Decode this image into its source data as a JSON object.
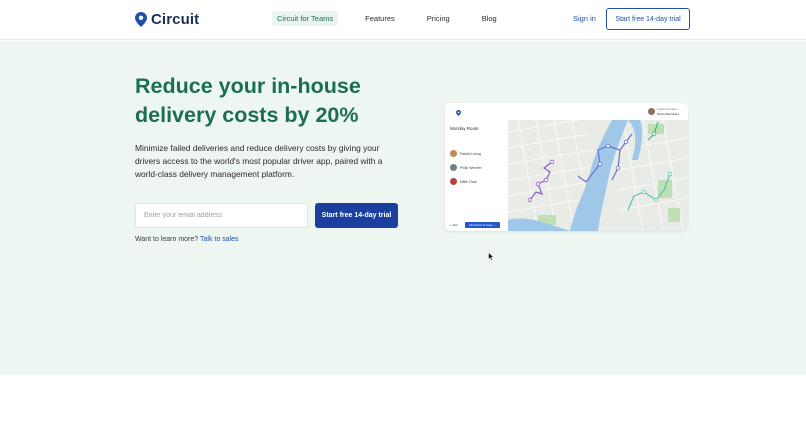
{
  "brand": {
    "name": "Circuit",
    "logo_icon": "map-pin-icon",
    "color": "#2150a6"
  },
  "nav": {
    "items": [
      {
        "label": "Circuit for Teams",
        "active": true
      },
      {
        "label": "Features",
        "active": false
      },
      {
        "label": "Pricing",
        "active": false
      },
      {
        "label": "Blog",
        "active": false
      }
    ],
    "signin_label": "Sign in",
    "trial_label": "Start free 14-day trial"
  },
  "hero": {
    "headline_line1": "Reduce your in-house",
    "headline_line2": "delivery costs by 20%",
    "subtext": "Minimize failed deliveries and reduce delivery costs by giving your drivers access to the world's most popular driver app, paired with a world-class delivery management platform.",
    "email_placeholder": "Enter your email address",
    "email_value": "",
    "cta_label": "Start free 14-day trial",
    "learn_text": "Want to learn more?",
    "learn_link": "Talk to sales",
    "colors": {
      "headline": "#1c6e53",
      "background": "#eef6f2",
      "cta": "#1b3f9e"
    }
  },
  "preview": {
    "route_title": "Monday Route",
    "drivers": [
      {
        "name": "Patrick Leung"
      },
      {
        "name": "Philip Wheeler"
      },
      {
        "name": "Millie Clark"
      }
    ],
    "user_line1": "Organization Name",
    "user_line2": "Marcel Bernardes",
    "bottom_left": "+ Edit",
    "bottom_button": "Add drivers & routes →"
  }
}
